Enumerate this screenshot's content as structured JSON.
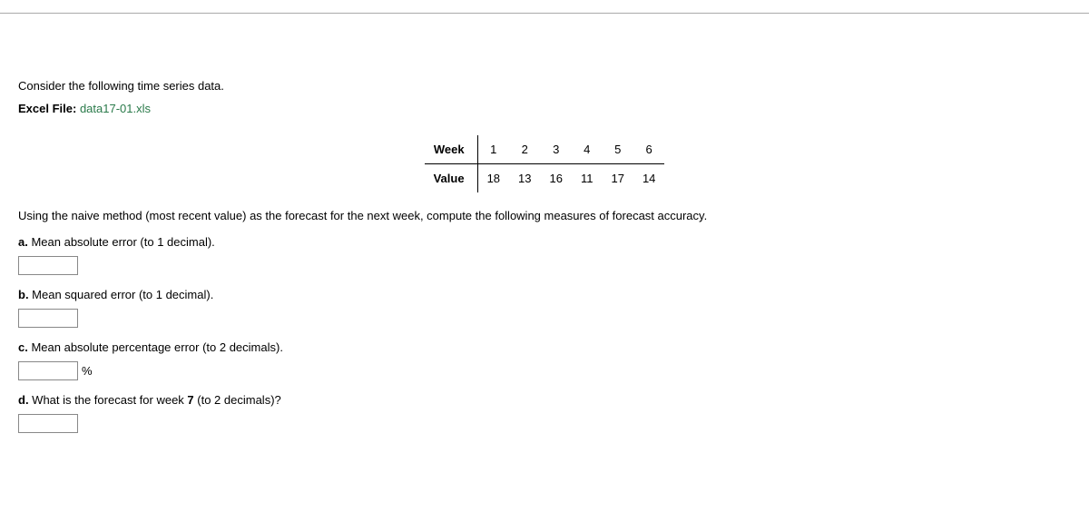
{
  "intro": "Consider the following time series data.",
  "excel_label": "Excel File:",
  "excel_file": "data17-01.xls",
  "table": {
    "row1_label": "Week",
    "row1": [
      "1",
      "2",
      "3",
      "4",
      "5",
      "6"
    ],
    "row2_label": "Value",
    "row2": [
      "18",
      "13",
      "16",
      "11",
      "17",
      "14"
    ]
  },
  "instruction": "Using the naive method (most recent value) as the forecast for the next week, compute the following measures of forecast accuracy.",
  "qa": {
    "a_letter": "a.",
    "a_text": " Mean absolute error (to 1 decimal).",
    "b_letter": "b.",
    "b_text": " Mean squared error (to 1 decimal).",
    "c_letter": "c.",
    "c_text": " Mean absolute percentage error (to 2 decimals).",
    "c_unit": "%",
    "d_letter": "d.",
    "d_text_pre": " What is the forecast for week ",
    "d_bold": "7",
    "d_text_post": " (to 2 decimals)?"
  }
}
